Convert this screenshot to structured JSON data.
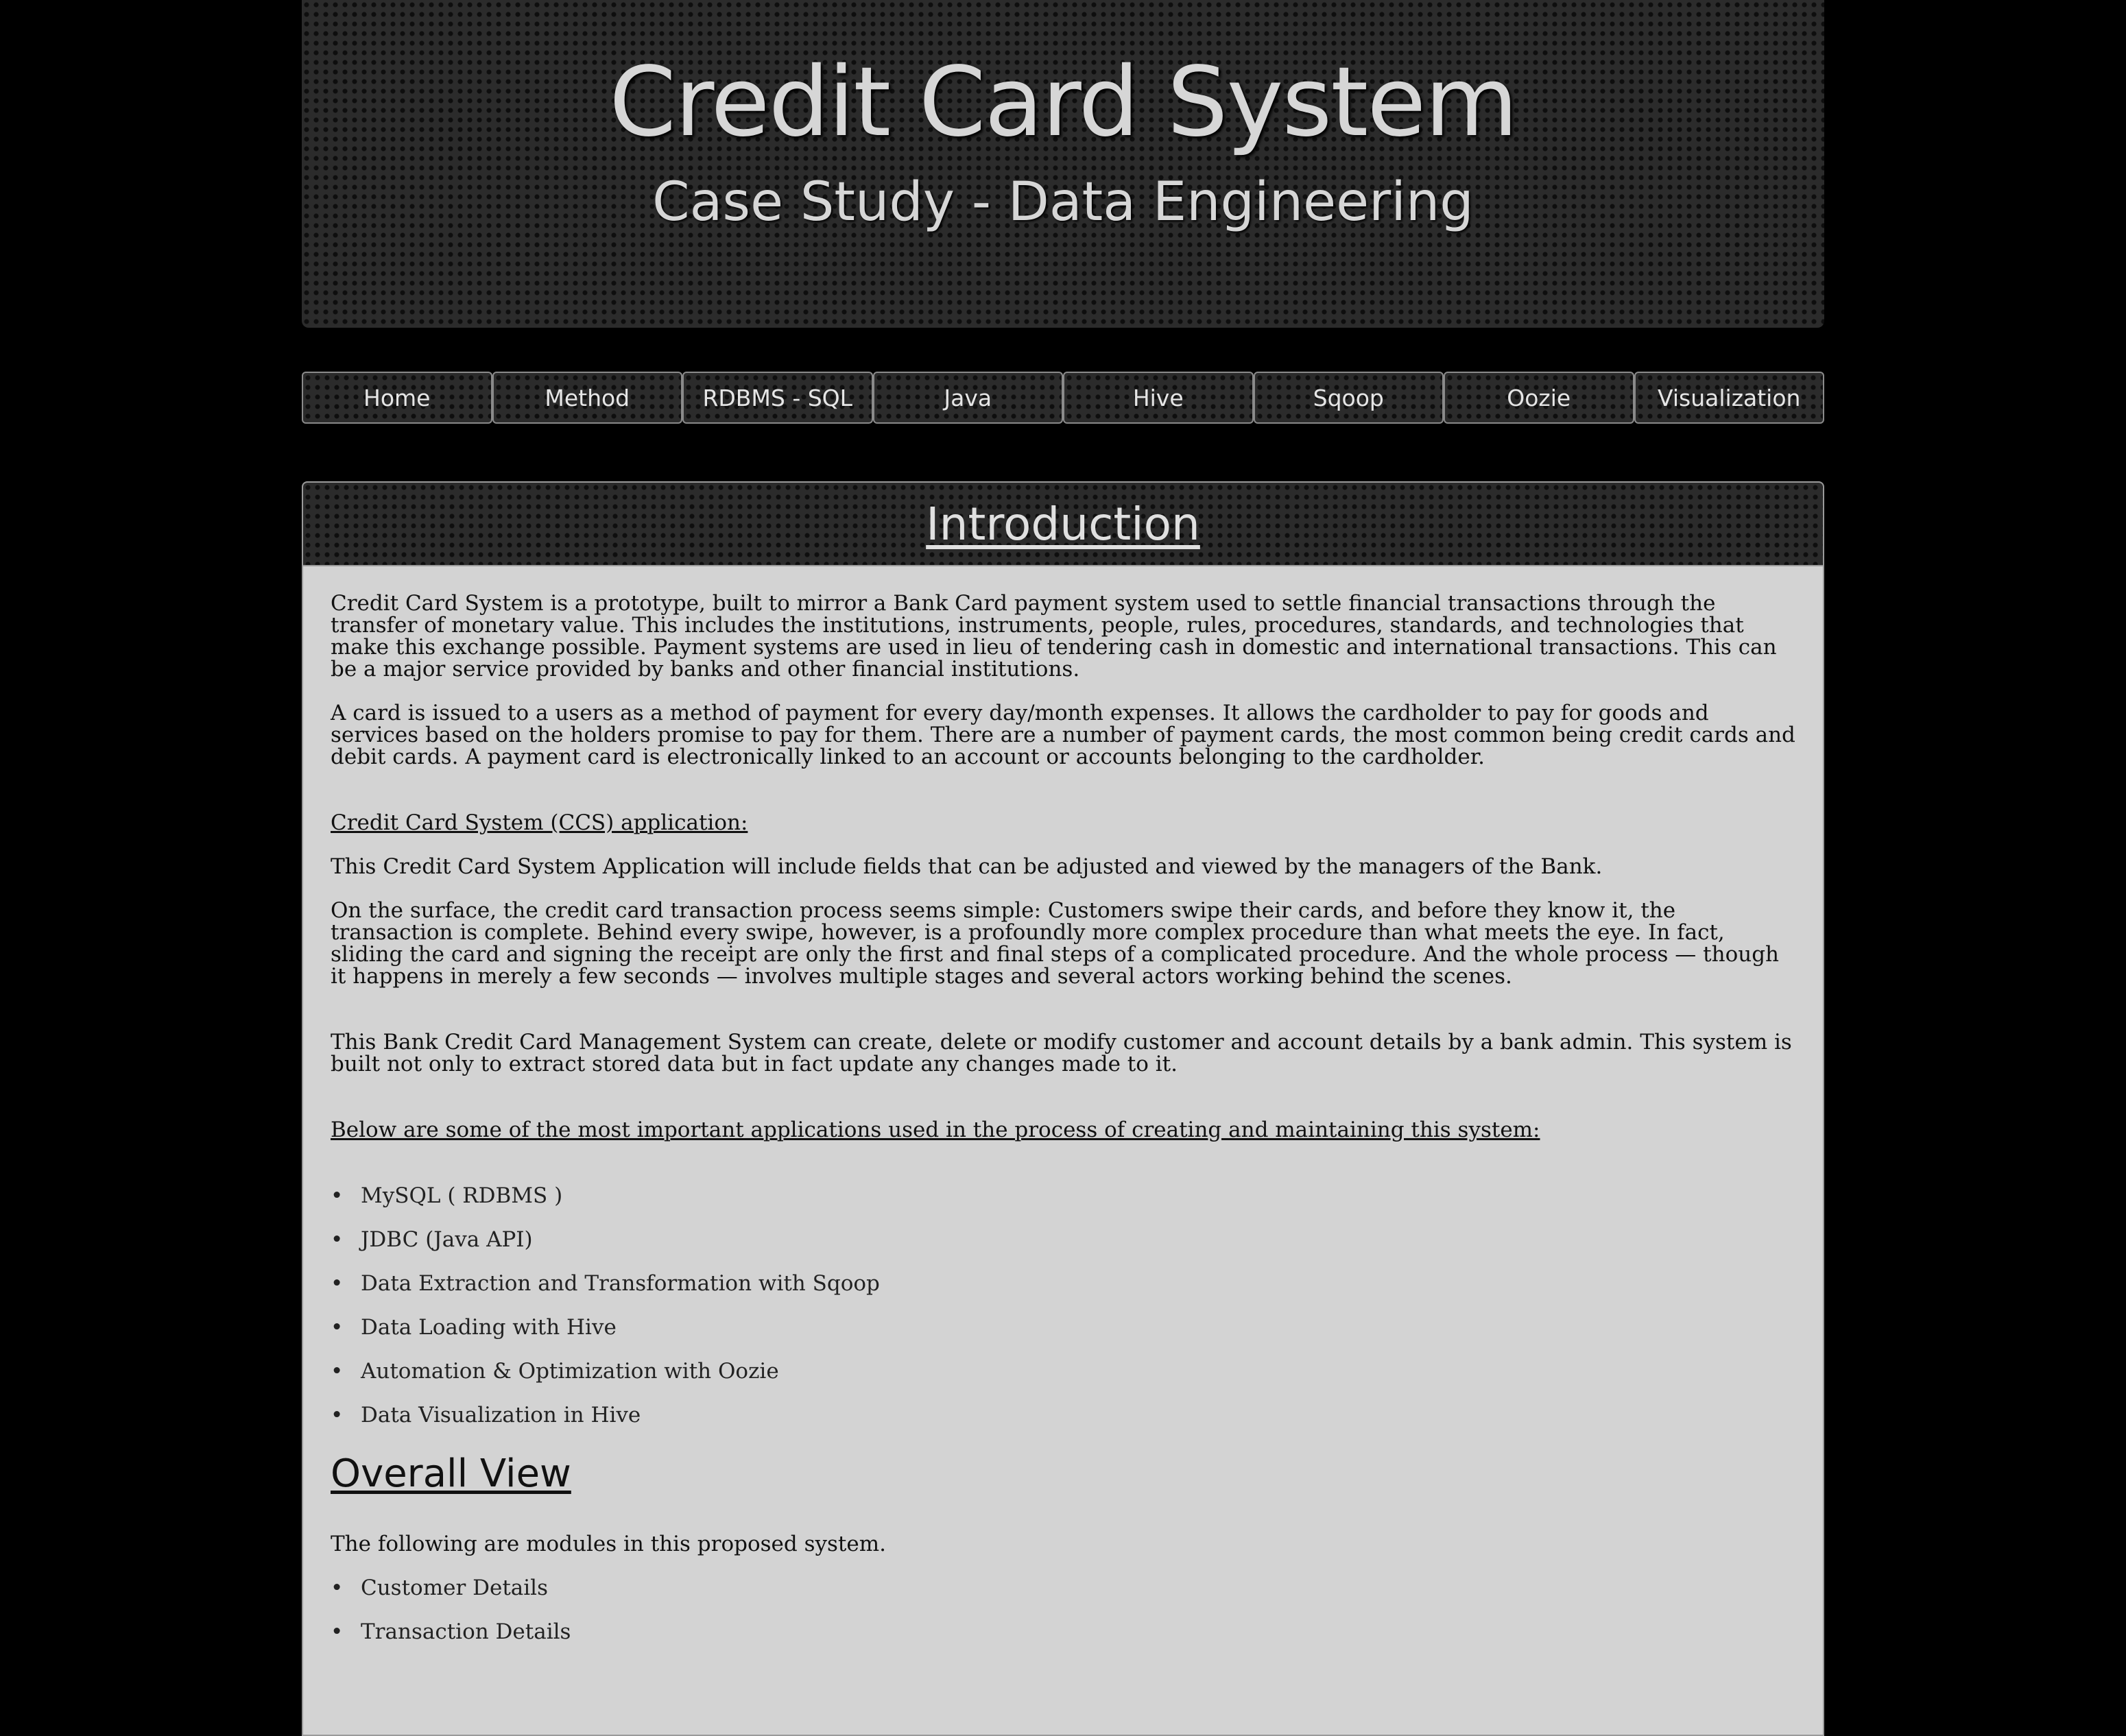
{
  "header": {
    "title": "Credit Card System",
    "subtitle": "Case Study - Data Engineering"
  },
  "nav": {
    "items": [
      {
        "label": "Home"
      },
      {
        "label": "Method"
      },
      {
        "label": "RDBMS - SQL"
      },
      {
        "label": "Java"
      },
      {
        "label": "Hive"
      },
      {
        "label": "Sqoop"
      },
      {
        "label": "Oozie"
      },
      {
        "label": "Visualization"
      }
    ]
  },
  "intro": {
    "heading": "Introduction",
    "p1": "Credit Card System is a prototype, built to mirror a Bank Card payment system used to settle financial transactions through the transfer of monetary value. This includes the institutions, instruments, people, rules, procedures, standards, and technologies that make this exchange possible.   Payment systems are used in lieu of tendering cash in domestic and international transactions. This can be a major service provided by banks and other financial institutions.",
    "p2": "A card is issued to a users as a method of payment for every day/month expenses. It allows the cardholder to pay for goods and services based on the holders promise to pay for them. There are a number of payment cards, the most common being credit cards and debit cards. A payment card is electronically linked to an account or accounts belonging to the cardholder.",
    "ccs_heading": "Credit Card System (CCS) application:",
    "p3": "This Credit Card System Application will include fields that can be adjusted and viewed by the managers of the Bank.",
    "p4": "On the surface, the credit card transaction process seems simple: Customers swipe their cards, and before they know it, the transaction is complete. Behind every swipe, however, is a profoundly more complex procedure than what meets the eye. In fact, sliding the card and signing the receipt are only the first and final steps of a complicated procedure. And the whole process — though it happens in merely a few seconds — involves multiple stages and several actors working behind the scenes.",
    "p5": "This Bank Credit Card Management System can create, delete or modify customer and account details by a bank admin. This system is built not only to extract stored data but in fact update any changes made to it.",
    "apps_heading": "Below are some of the most important applications used in the process of creating and maintaining this system:",
    "apps": [
      "MySQL ( RDBMS )",
      "JDBC (Java API)",
      "Data Extraction and Transformation with Sqoop",
      "Data Loading with Hive",
      "Automation & Optimization with Oozie",
      "Data Visualization in Hive"
    ]
  },
  "overall": {
    "heading": "Overall View",
    "intro": "The following are modules in this proposed system.",
    "modules": [
      "Customer Details",
      "Transaction Details"
    ]
  }
}
